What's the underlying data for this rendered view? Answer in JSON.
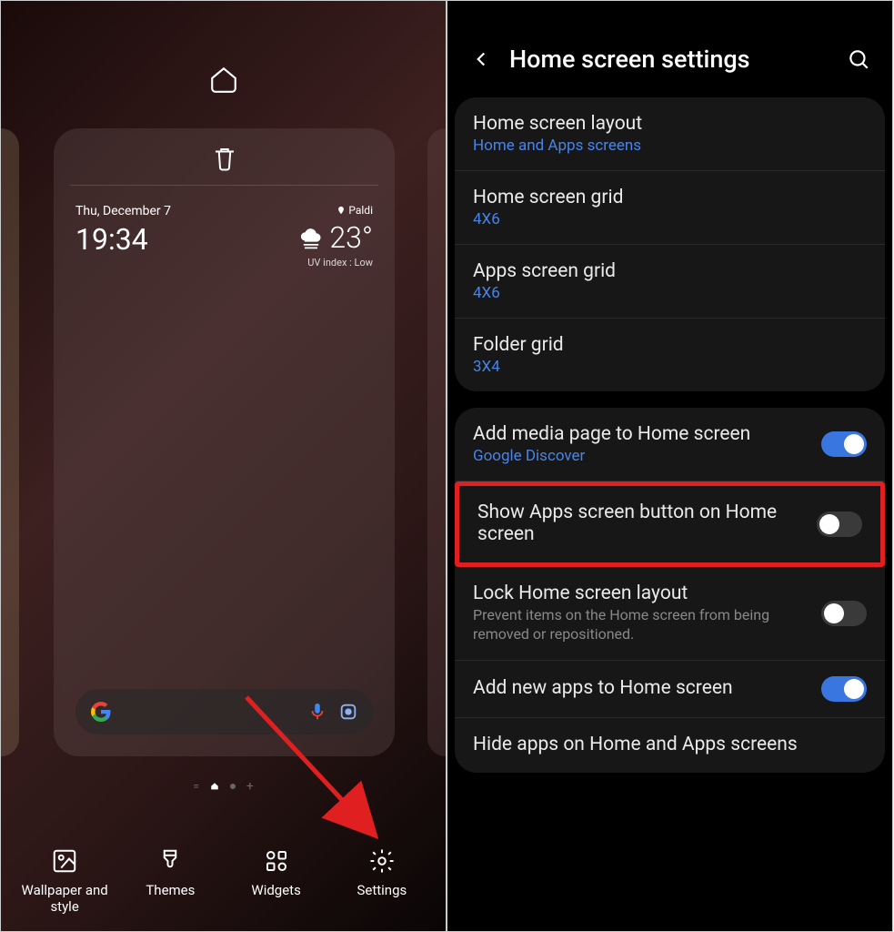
{
  "left": {
    "widget": {
      "date": "Thu, December 7",
      "time": "19:34",
      "location": "Paldi",
      "temp": "23°",
      "uv": "UV index : Low"
    },
    "bottombar": [
      {
        "label": "Wallpaper and style"
      },
      {
        "label": "Themes"
      },
      {
        "label": "Widgets"
      },
      {
        "label": "Settings"
      }
    ]
  },
  "right": {
    "title": "Home screen settings",
    "group1": [
      {
        "label": "Home screen layout",
        "sub": "Home and Apps screens"
      },
      {
        "label": "Home screen grid",
        "sub": "4X6"
      },
      {
        "label": "Apps screen grid",
        "sub": "4X6"
      },
      {
        "label": "Folder grid",
        "sub": "3X4"
      }
    ],
    "group2": {
      "media": {
        "label": "Add media page to Home screen",
        "sub": "Google Discover"
      },
      "showapps": {
        "label": "Show Apps screen button on Home screen"
      },
      "lock": {
        "label": "Lock Home screen layout",
        "desc": "Prevent items on the Home screen from being removed or repositioned."
      },
      "newapps": {
        "label": "Add new apps to Home screen"
      },
      "hide": {
        "label": "Hide apps on Home and Apps screens"
      }
    }
  }
}
